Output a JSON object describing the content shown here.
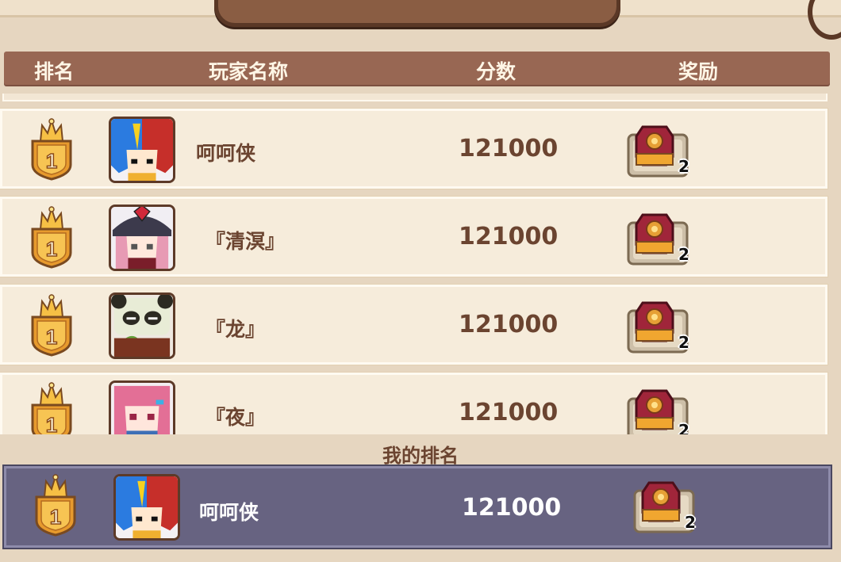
{
  "title": "",
  "header": {
    "rank": "排名",
    "player_name": "玩家名称",
    "score": "分数",
    "reward": "奖励"
  },
  "rows": [
    {
      "rank": "1",
      "name": "呵呵侠",
      "score": "121000",
      "reward_count": "2",
      "avatar": "hero-blue-red-hair"
    },
    {
      "rank": "1",
      "name": "『清溟』",
      "score": "121000",
      "reward_count": "2",
      "avatar": "witch-hat-girl"
    },
    {
      "rank": "1",
      "name": "『龙』",
      "score": "121000",
      "reward_count": "2",
      "avatar": "panda-bamboo"
    },
    {
      "rank": "1",
      "name": "『夜』",
      "score": "121000",
      "reward_count": "2",
      "avatar": "pink-hair-girl"
    }
  ],
  "my_rank": {
    "label": "我的排名",
    "rank": "1",
    "name": "呵呵侠",
    "score": "121000",
    "reward_count": "2",
    "avatar": "hero-blue-red-hair"
  },
  "colors": {
    "header_bar": "#986753",
    "row_bg": "#f6ecdb",
    "my_row_bg": "#676381",
    "text_brown": "#6b4430"
  }
}
